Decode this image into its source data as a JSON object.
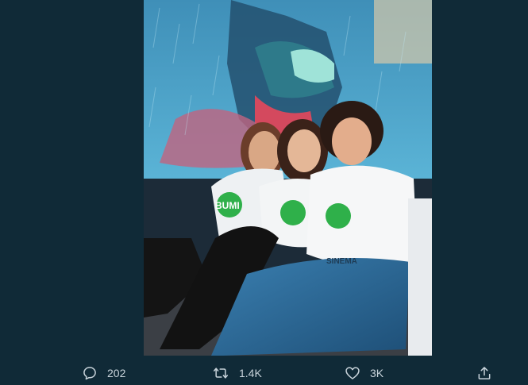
{
  "tweet": {
    "media": {
      "icon": "photo",
      "hoodie_text_1": "BUMI",
      "hoodie_text_2": "SINEMA"
    },
    "actions": {
      "reply": {
        "icon": "reply-icon",
        "count": "202"
      },
      "retweet": {
        "icon": "retweet-icon",
        "count": "1.4K"
      },
      "like": {
        "icon": "heart-icon",
        "count": "3K"
      },
      "share": {
        "icon": "share-icon"
      }
    }
  },
  "colors": {
    "background": "#102a37",
    "icon": "#c8d3da",
    "hoodie_logo": "#2fb04a"
  }
}
